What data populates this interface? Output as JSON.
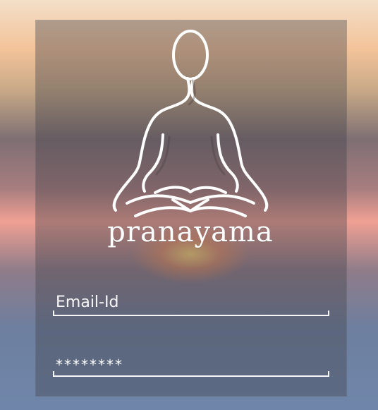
{
  "app": {
    "name": "pranayama"
  },
  "login": {
    "email": {
      "placeholder": "Email-Id",
      "value": ""
    },
    "password": {
      "masked_value": "********"
    }
  },
  "branding": {
    "logo_icon": "meditating-figure-icon"
  },
  "colors": {
    "panel": "#3e4046",
    "text": "#ffffff",
    "sky_top": "#f3dfc8",
    "sky_mid": "#f0a093",
    "sky_bottom": "#6f86aa"
  }
}
